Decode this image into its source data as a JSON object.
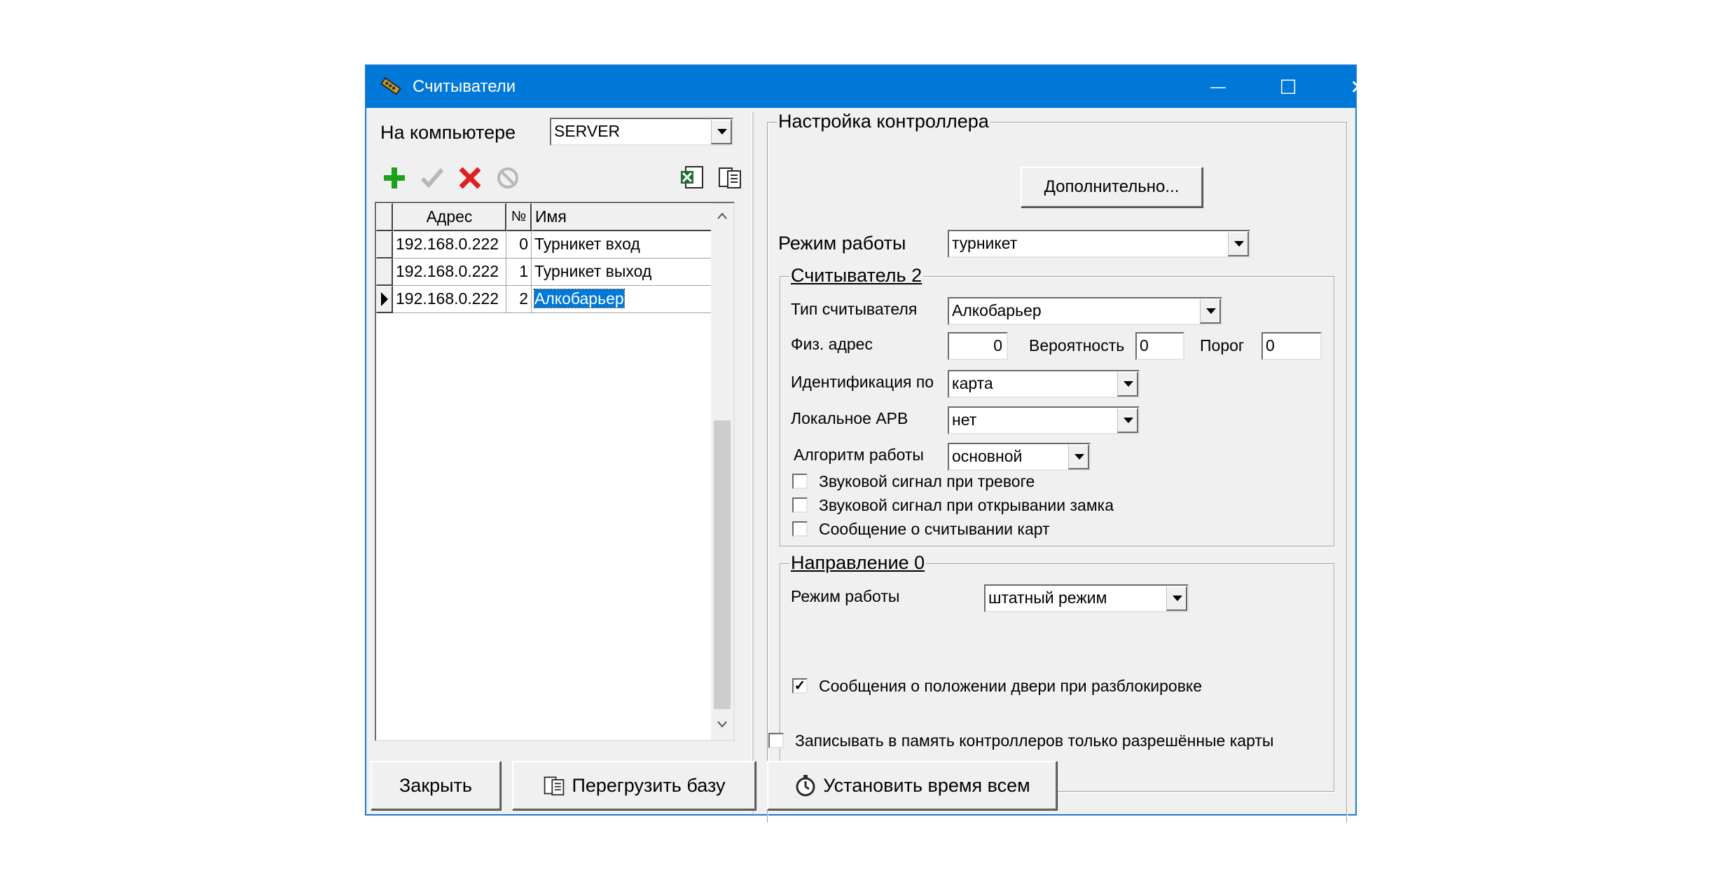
{
  "window": {
    "title": "Считыватели",
    "minimize_glyph": "—",
    "maximize_glyph": "☐",
    "close_glyph": "✕"
  },
  "left": {
    "computer_label": "На компьютере",
    "computer_value": "SERVER",
    "table": {
      "headers": [
        "Адрес",
        "№",
        "Имя"
      ],
      "rows": [
        {
          "address": "192.168.0.222",
          "num": "0",
          "name": "Турникет вход"
        },
        {
          "address": "192.168.0.222",
          "num": "1",
          "name": "Турникет выход"
        },
        {
          "address": "192.168.0.222",
          "num": "2",
          "name": "Алкобарьер"
        }
      ]
    },
    "toolbar_icons": [
      "add-icon",
      "confirm-icon",
      "delete-icon",
      "cancel-icon",
      "excel-export-icon",
      "reload-icon"
    ]
  },
  "controller": {
    "group_title": "Настройка контроллера",
    "advanced_button": "Дополнительно...",
    "mode_label": "Режим работы",
    "mode_value": "турникет",
    "reader": {
      "title": "Считыватель 2",
      "type_label": "Тип считывателя",
      "type_value": "Алкобарьер",
      "address_label": "Физ. адрес",
      "address_value": "0",
      "probability_label": "Вероятность",
      "probability_value": "0",
      "threshold_label": "Порог",
      "threshold_value": "0",
      "ident_label": "Идентификация по",
      "ident_value": "карта",
      "apb_label": "Локальное APB",
      "apb_value": "нет",
      "algo_label": "Алгоритм работы",
      "algo_value": "основной",
      "chk_alarm_sound": "Звуковой сигнал при тревоге",
      "chk_lock_sound": "Звуковой сигнал при открывании замка",
      "chk_card_msg": "Сообщение о считывании карт"
    },
    "direction": {
      "title": "Направление 0",
      "mode_label": "Режим работы",
      "mode_value": "штатный режим",
      "chk_door_msg": "Сообщения о положении двери при разблокировке",
      "chk_door_msg_checked": true
    },
    "chk_allowed_only": "Записывать в память контроллеров только разрешённые карты"
  },
  "bottom": {
    "close_button": "Закрыть",
    "reload_button": "Перегрузить базу",
    "settime_button": "Установить время всем"
  },
  "colors": {
    "titlebar": "#0078d7",
    "selection": "#0078d7",
    "add_green": "#1aa31a",
    "delete_red": "#e02020"
  }
}
